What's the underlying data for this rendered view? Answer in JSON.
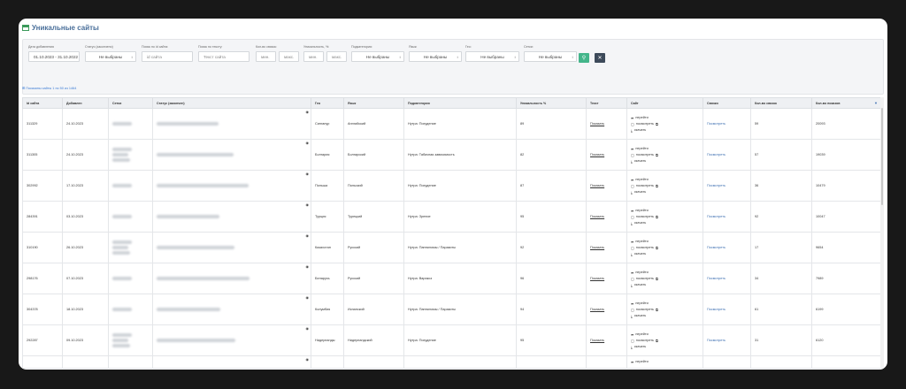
{
  "page": {
    "title": "Уникальные сайты"
  },
  "filters": {
    "date_label": "Дата добавления",
    "date_value": "01.10.2023 - 31.10.2022",
    "status_label": "Статус (закончено)",
    "status_value": "Не выбраны",
    "search_id_label": "Поиск по id сайта:",
    "search_id_placeholder": "id сайта",
    "search_text_label": "Поиск по тексту:",
    "search_text_placeholder": "Текст сайта",
    "links_label": "Кол-во связок:",
    "min_placeholder": "мин.",
    "max_placeholder": "макс.",
    "uniq_label": "Уникальность, %:",
    "subcat_label": "Подкатегория:",
    "subcat_value": "Не выбраны",
    "lang_label": "Язык:",
    "lang_value": "Не выбраны",
    "geo_label": "Гео:",
    "geo_value": "Не выбраны",
    "nets_label": "Сетки:",
    "nets_value": "Не выбраны",
    "search_icon": "search-icon",
    "reset_icon": "close-icon"
  },
  "shown_text": "⊞ Показаны сайты 1 по 50 из 1464",
  "table": {
    "headers": [
      "Id сайта",
      "Добавлен",
      "Сетки",
      "Статус (закончен)",
      "Гео",
      "Язык",
      "Подкатегория",
      "Уникальность %",
      "Текст",
      "Сайт",
      "Связки",
      "Кол-во связок",
      "Кол-во показов"
    ],
    "site_links": {
      "open": "перейти",
      "view": "посмотреть",
      "download": "скачать"
    },
    "show_label": "Показать",
    "links_action": "Посмотреть",
    "rows": [
      {
        "id": "311329",
        "added": "24.10.2023",
        "geo": "Сингапур",
        "lang": "Английский",
        "subcat": "Нутра: Похудение",
        "uniq": "89",
        "links": "59",
        "views": "20093"
      },
      {
        "id": "311305",
        "added": "24.10.2023",
        "geo": "Болгария",
        "lang": "Болгарский",
        "subcat": "Нутра: Табачная зависимость",
        "uniq": "82",
        "links": "57",
        "views": "19039"
      },
      {
        "id": "302992",
        "added": "17.10.2023",
        "geo": "Польша",
        "lang": "Польский",
        "subcat": "Нутра: Похудение",
        "uniq": "87",
        "links": "36",
        "views": "10479"
      },
      {
        "id": "284391",
        "added": "03.10.2023",
        "geo": "Турция",
        "lang": "Турецкий",
        "subcat": "Нутра: Зрение",
        "uniq": "95",
        "links": "92",
        "views": "10047"
      },
      {
        "id": "310190",
        "added": "26.10.2023",
        "geo": "Казахстан",
        "lang": "Русский",
        "subcat": "Нутра: Паппиломы / Паразиты",
        "uniq": "92",
        "links": "17",
        "views": "9654"
      },
      {
        "id": "298176",
        "added": "07.10.2023",
        "geo": "Беларусь",
        "lang": "Русский",
        "subcat": "Нутра: Варикоз",
        "uniq": "96",
        "links": "34",
        "views": "7989"
      },
      {
        "id": "304378",
        "added": "18.10.2023",
        "geo": "Колумбия",
        "lang": "Испанский",
        "subcat": "Нутра: Паппиломы / Паразиты",
        "uniq": "94",
        "links": "61",
        "views": "6199"
      },
      {
        "id": "292287",
        "added": "09.10.2023",
        "geo": "Нидерланды",
        "lang": "Нидерландский",
        "subcat": "Нутра: Похудение",
        "uniq": "95",
        "links": "31",
        "views": "6120"
      },
      {
        "id": "",
        "added": "",
        "geo": "",
        "lang": "",
        "subcat": "",
        "uniq": "",
        "links": "",
        "views": ""
      }
    ]
  }
}
